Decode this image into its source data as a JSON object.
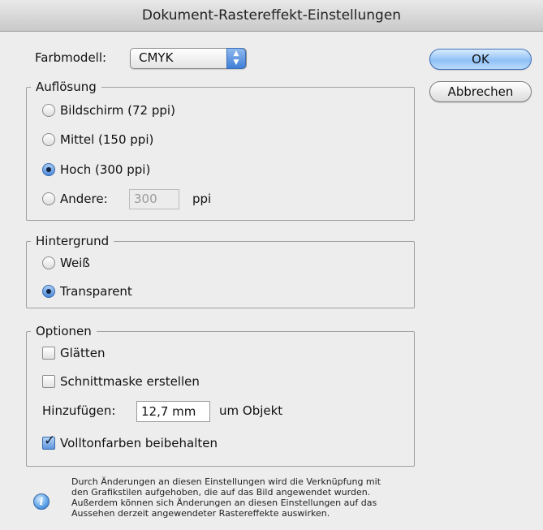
{
  "window": {
    "title": "Dokument-Rastereffekt-Einstellungen"
  },
  "color_model": {
    "label": "Farbmodell:",
    "value": "CMYK"
  },
  "buttons": {
    "ok": "OK",
    "cancel": "Abbrechen"
  },
  "resolution": {
    "legend": "Auflösung",
    "options": [
      {
        "label": "Bildschirm (72 ppi)",
        "selected": false
      },
      {
        "label": "Mittel (150 ppi)",
        "selected": false
      },
      {
        "label": "Hoch (300 ppi)",
        "selected": true
      },
      {
        "label": "Andere:",
        "selected": false
      }
    ],
    "other_value": "300",
    "other_unit": "ppi"
  },
  "background": {
    "legend": "Hintergrund",
    "options": [
      {
        "label": "Weiß",
        "selected": false
      },
      {
        "label": "Transparent",
        "selected": true
      }
    ]
  },
  "options": {
    "legend": "Optionen",
    "antialias": {
      "label": "Glätten",
      "checked": false
    },
    "clipping_mask": {
      "label": "Schnittmaske erstellen",
      "checked": false
    },
    "add_label": "Hinzufügen:",
    "add_value": "12,7 mm",
    "add_suffix": "um Objekt",
    "preserve_spot": {
      "label": "Volltonfarben beibehalten",
      "checked": true
    }
  },
  "note": {
    "icon": "info-icon",
    "lines": [
      "Durch Änderungen an diesen Einstellungen wird die Verknüpfung mit",
      "den Grafikstilen aufgehoben, die auf das Bild angewendet wurden.",
      "Außerdem können sich Änderungen an diesen Einstellungen auf das",
      "Aussehen derzeit angewendeter Rastereffekte auswirken."
    ]
  }
}
